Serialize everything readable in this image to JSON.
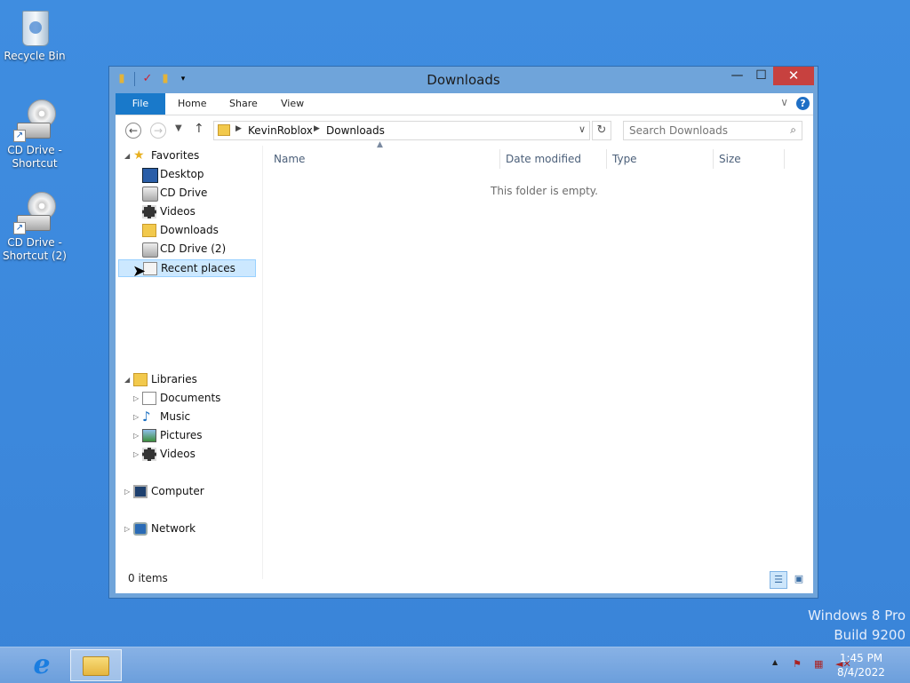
{
  "desktop": {
    "icons": [
      {
        "label": "Recycle Bin"
      },
      {
        "label": "CD Drive - Shortcut"
      },
      {
        "label": "CD Drive - Shortcut (2)"
      }
    ],
    "watermark": {
      "line1": "Windows 8 Pro",
      "line2": "Build 9200"
    }
  },
  "window": {
    "title": "Downloads",
    "controls": {
      "minimize": "—",
      "maximize": "☐",
      "close": "✕"
    },
    "ribbon": {
      "tabs": [
        "File",
        "Home",
        "Share",
        "View"
      ]
    },
    "address": {
      "breadcrumbs": [
        "KevinRoblox",
        "Downloads"
      ],
      "search_placeholder": "Search Downloads"
    },
    "nav": {
      "favorites": {
        "label": "Favorites",
        "items": [
          "Desktop",
          "CD Drive",
          "Videos",
          "Downloads",
          "CD Drive (2)",
          "Recent places"
        ],
        "selected": "Recent places"
      },
      "libraries": {
        "label": "Libraries",
        "items": [
          "Documents",
          "Music",
          "Pictures",
          "Videos"
        ]
      },
      "computer": {
        "label": "Computer"
      },
      "network": {
        "label": "Network"
      }
    },
    "list": {
      "columns": [
        "Name",
        "Date modified",
        "Type",
        "Size"
      ],
      "empty_message": "This folder is empty."
    },
    "status": {
      "item_count": "0 items"
    }
  },
  "taskbar": {
    "apps": [
      "Internet Explorer",
      "File Explorer"
    ],
    "clock": {
      "time": "1:45 PM",
      "date": "8/4/2022"
    }
  },
  "icons": {
    "recycle_bin": "recycle-bin-icon",
    "cd_drive": "cd-drive-icon",
    "star": "star-icon",
    "folder": "folder-icon"
  },
  "colors": {
    "desktop_bg": "#3f8de0",
    "window_frame": "#6fa4da",
    "file_tab": "#1979ca",
    "close_button": "#c7413f",
    "selection": "#cce8ff"
  }
}
